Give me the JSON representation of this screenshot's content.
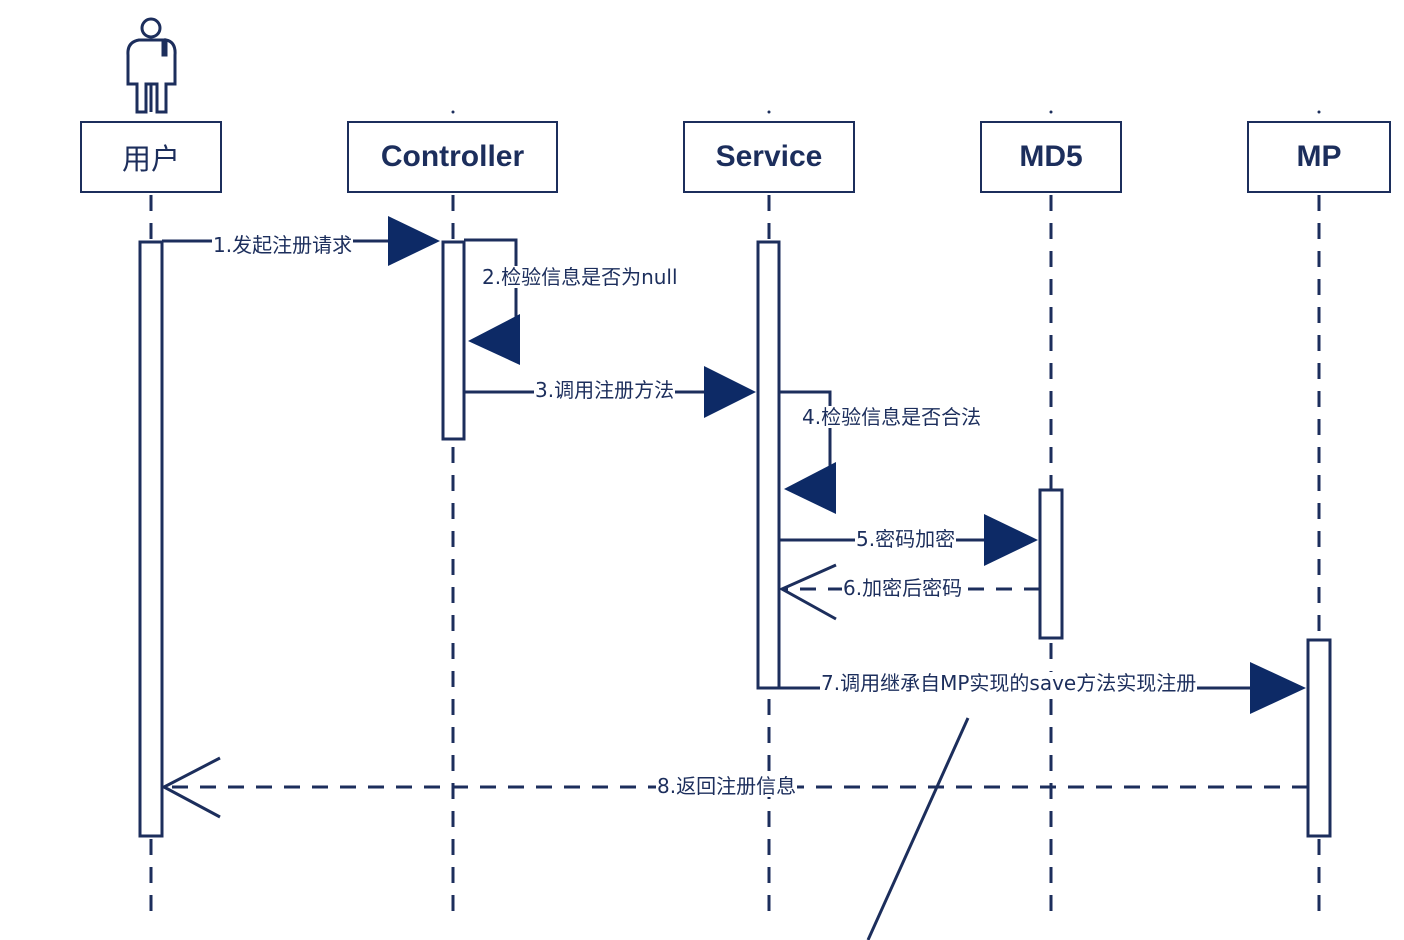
{
  "participants": [
    {
      "id": "user",
      "name": "用户",
      "actor": true
    },
    {
      "id": "controller",
      "name": "Controller"
    },
    {
      "id": "service",
      "name": "Service"
    },
    {
      "id": "md5",
      "name": "MD5"
    },
    {
      "id": "mp",
      "name": "MP"
    }
  ],
  "messages": [
    {
      "id": "m1",
      "label": "1.发起注册请求",
      "from": "user",
      "to": "controller",
      "style": "sync"
    },
    {
      "id": "m2",
      "label": "2.检验信息是否为null",
      "from": "controller",
      "to": "controller",
      "style": "self"
    },
    {
      "id": "m3",
      "label": "3.调用注册方法",
      "from": "controller",
      "to": "service",
      "style": "sync"
    },
    {
      "id": "m4",
      "label": "4.检验信息是否合法",
      "from": "service",
      "to": "service",
      "style": "self"
    },
    {
      "id": "m5",
      "label": "5.密码加密",
      "from": "service",
      "to": "md5",
      "style": "sync"
    },
    {
      "id": "m6",
      "label": "6.加密后密码",
      "from": "md5",
      "to": "service",
      "style": "return"
    },
    {
      "id": "m7",
      "label": "7.调用继承自MP实现的save方法实现注册",
      "from": "service",
      "to": "mp",
      "style": "sync"
    },
    {
      "id": "m8",
      "label": "8.返回注册信息",
      "from": "mp",
      "to": "user",
      "style": "return"
    }
  ],
  "colors": {
    "ink": "#1c2e5c",
    "arrowhead": "#0d2a66",
    "background": "#ffffff"
  }
}
